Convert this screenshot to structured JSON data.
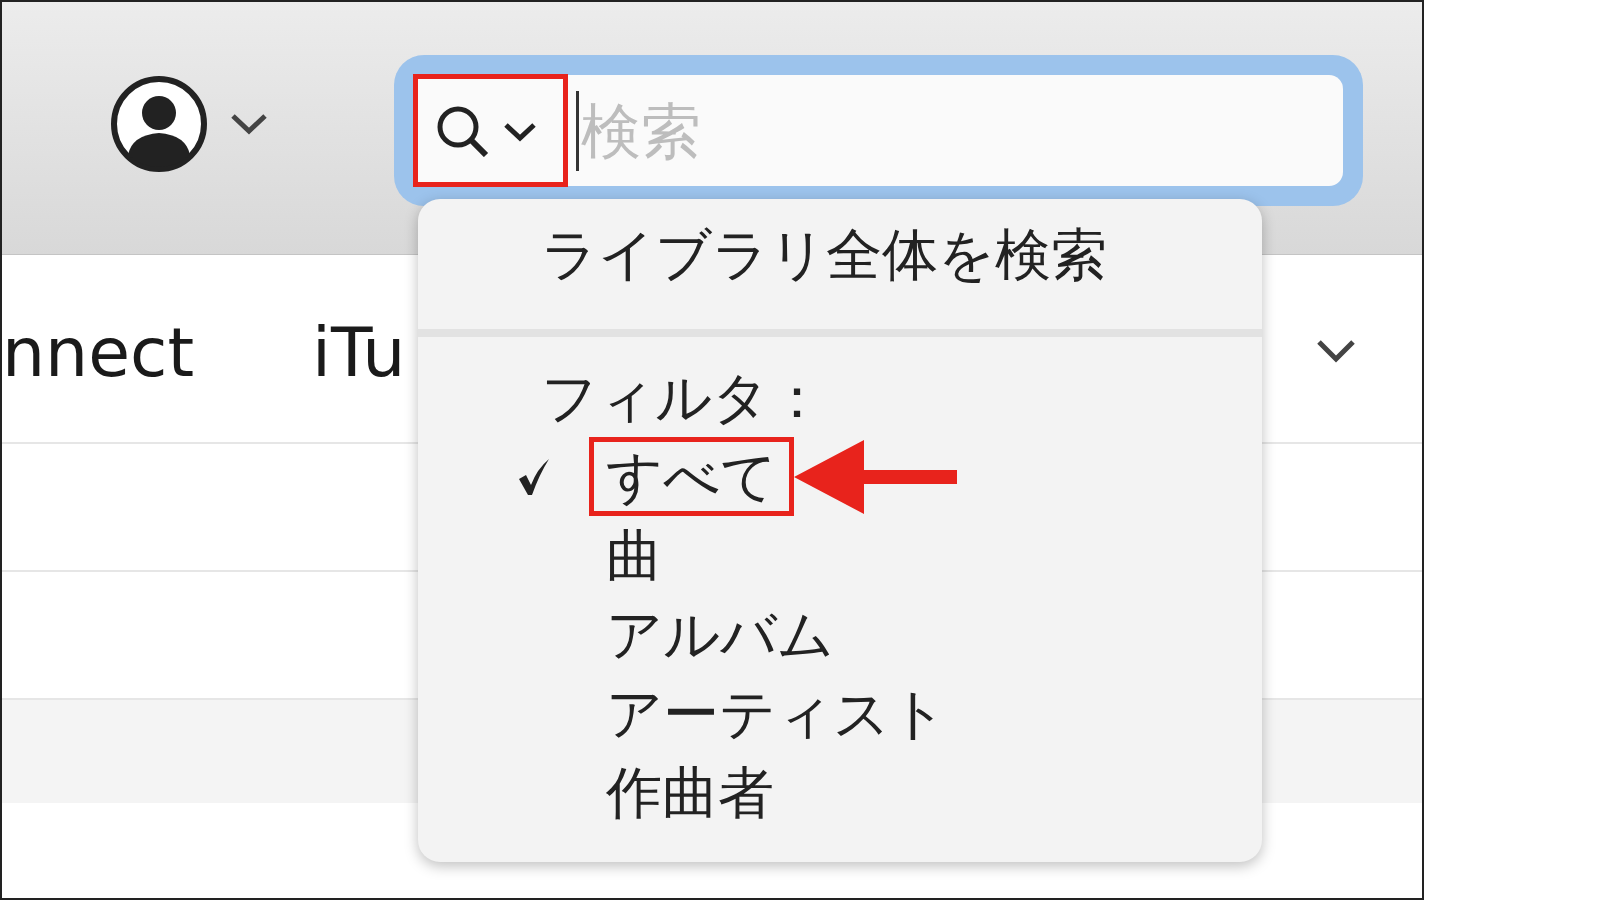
{
  "search": {
    "placeholder": "検索",
    "scope_highlighted": true
  },
  "header_items": [
    {
      "label": "nnect"
    },
    {
      "label": "iTu"
    }
  ],
  "menu": {
    "items": [
      {
        "kind": "action",
        "label": "ライブラリ全体を検索"
      },
      {
        "kind": "separator"
      },
      {
        "kind": "header",
        "label": "フィルタ："
      },
      {
        "kind": "option",
        "label": "すべて",
        "selected": true,
        "highlighted": true
      },
      {
        "kind": "option",
        "label": "曲",
        "selected": false,
        "highlighted": false
      },
      {
        "kind": "option",
        "label": "アルバム",
        "selected": false,
        "highlighted": false
      },
      {
        "kind": "option",
        "label": "アーティスト",
        "selected": false,
        "highlighted": false
      },
      {
        "kind": "option",
        "label": "作曲者",
        "selected": false,
        "highlighted": false
      }
    ]
  }
}
